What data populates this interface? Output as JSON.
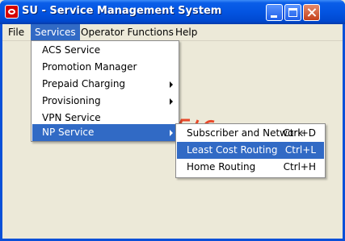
{
  "window": {
    "title": "SU - Service Management System"
  },
  "menubar": {
    "items": [
      {
        "label": "File"
      },
      {
        "label": "Services"
      },
      {
        "label": "Operator Functions"
      },
      {
        "label": "Help"
      }
    ]
  },
  "services_menu": {
    "items": [
      {
        "label": "ACS Service"
      },
      {
        "label": "Promotion Manager"
      },
      {
        "label": "Prepaid Charging"
      },
      {
        "label": "Provisioning"
      },
      {
        "label": "VPN Service"
      },
      {
        "label": "NP Service"
      }
    ]
  },
  "np_submenu": {
    "items": [
      {
        "label": "Subscriber and Network",
        "shortcut": "Ctrl+D"
      },
      {
        "label": "Least Cost Routing",
        "shortcut": "Ctrl+L"
      },
      {
        "label": "Home Routing",
        "shortcut": "Ctrl+H"
      }
    ]
  },
  "colors": {
    "selection": "#316ac5",
    "titlebar": "#0354e1"
  }
}
